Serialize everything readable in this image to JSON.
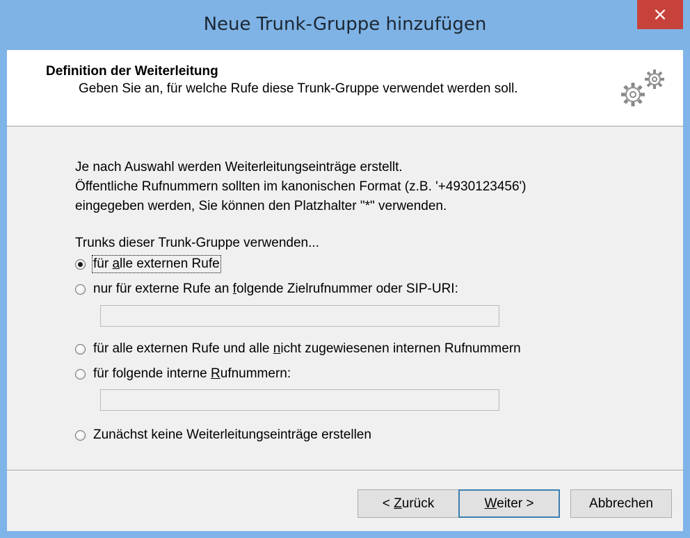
{
  "window": {
    "title": "Neue Trunk-Gruppe hinzufügen",
    "close_glyph": "×"
  },
  "header": {
    "title": "Definition der Weiterleitung",
    "subtitle": "Geben Sie an, für welche Rufe diese Trunk-Gruppe verwendet werden soll.",
    "icon": "gears-icon"
  },
  "intro": {
    "line1": "Je nach Auswahl werden Weiterleitungseinträge erstellt.",
    "line2": "Öffentliche Rufnummern sollten im kanonischen Format (z.B. '+4930123456')",
    "line3": "eingegeben werden, Sie können den Platzhalter \"*\" verwenden."
  },
  "options": {
    "group_label": "Trunks dieser Trunk-Gruppe verwenden...",
    "opt1": {
      "before": "für ",
      "mnemonic": "a",
      "after": "lle externen Rufe",
      "checked": true
    },
    "opt2": {
      "before": "nur für externe Rufe an ",
      "mnemonic": "f",
      "after": "olgende Zielrufnummer oder SIP-URI:",
      "checked": false
    },
    "opt2_value": "",
    "opt3": {
      "before": "für alle externen Rufe und alle ",
      "mnemonic": "n",
      "after": "icht zugewiesenen internen Rufnummern",
      "checked": false
    },
    "opt4": {
      "before": "für folgende interne ",
      "mnemonic": "R",
      "after": "ufnummern:",
      "checked": false
    },
    "opt4_value": "",
    "opt5": {
      "before": "Zunächst keine Weiterleitungseinträge erstellen",
      "mnemonic": "",
      "after": "",
      "checked": false
    }
  },
  "buttons": {
    "back": {
      "before": "< ",
      "mnemonic": "Z",
      "after": "urück"
    },
    "next": {
      "before": "",
      "mnemonic": "W",
      "after": "eiter >"
    },
    "cancel": "Abbrechen"
  },
  "colors": {
    "titlebar": "#7fb3e5",
    "close": "#c7423a",
    "default_button_border": "#3c7fb1"
  }
}
